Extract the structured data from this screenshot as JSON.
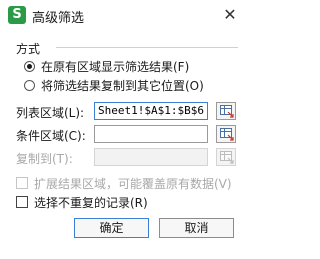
{
  "dialog": {
    "app_icon_text": "S",
    "title": "高级筛选",
    "close_glyph": "✕"
  },
  "method": {
    "group_label": "方式",
    "options": [
      {
        "label": "在原有区域显示筛选结果(F)",
        "selected": true
      },
      {
        "label": "将筛选结果复制到其它位置(O)",
        "selected": false
      }
    ]
  },
  "fields": {
    "list_range": {
      "label": "列表区域(L):",
      "value": "Sheet1!$A$1:$B$6"
    },
    "criteria_range": {
      "label": "条件区域(C):",
      "value": ""
    },
    "copy_to": {
      "label": "复制到(T):",
      "value": "",
      "disabled": true
    }
  },
  "options": {
    "extend_range": {
      "label": "扩展结果区域，可能覆盖原有数据(V)",
      "checked": false,
      "disabled": true
    },
    "unique_records": {
      "label": "选择不重复的记录(R)",
      "checked": false
    }
  },
  "buttons": {
    "ok": "确定",
    "cancel": "取消"
  },
  "icons": {
    "app": "wps-spreadsheet-icon",
    "close": "close-icon",
    "range_picker": "range-picker-icon"
  },
  "colors": {
    "app_icon_bg": "#2b9a47",
    "active_border": "#3b7fd6",
    "disabled_text": "#a8a8a8"
  }
}
